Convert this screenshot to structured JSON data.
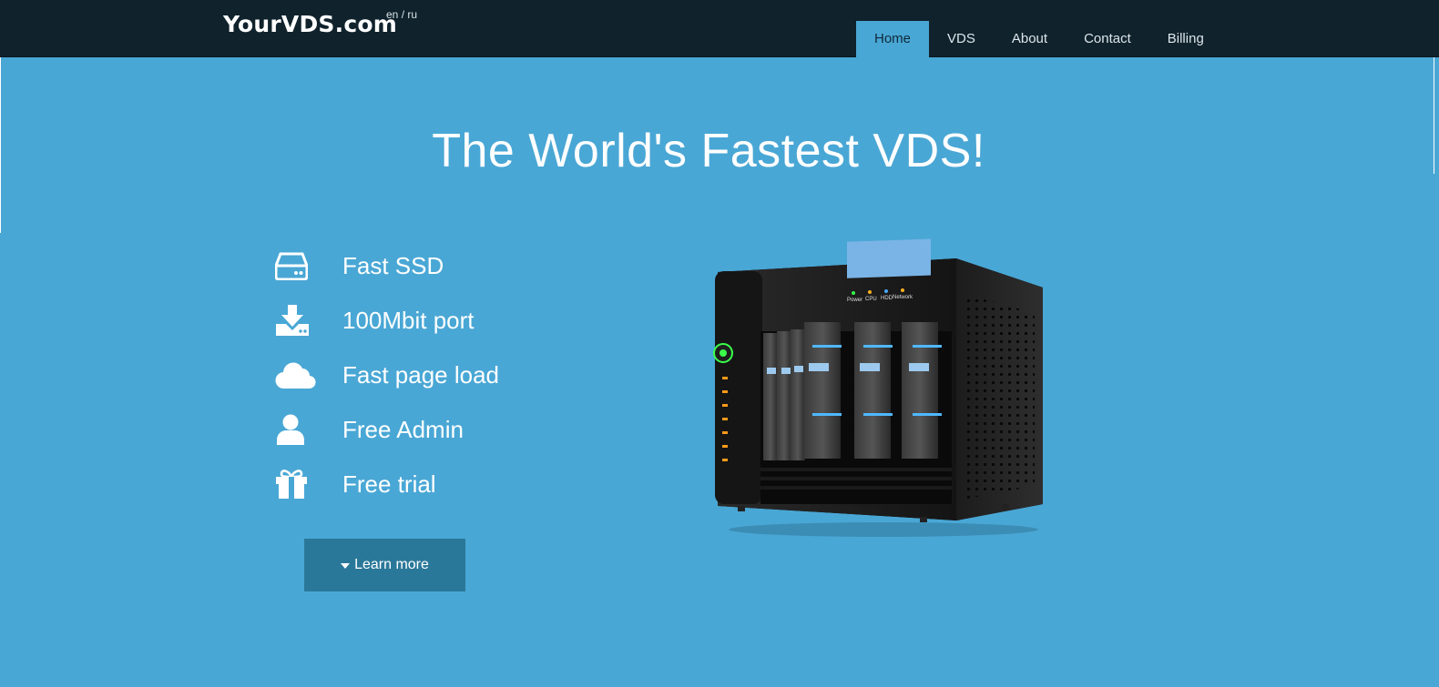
{
  "brand": {
    "name": "YourVDS.com",
    "lang_en": "en",
    "lang_sep": " / ",
    "lang_ru": "ru"
  },
  "nav": {
    "items": [
      {
        "label": "Home",
        "active": true
      },
      {
        "label": "VDS"
      },
      {
        "label": "About"
      },
      {
        "label": "Contact"
      },
      {
        "label": "Billing"
      }
    ]
  },
  "hero": {
    "title": "The World's Fastest VDS!",
    "features": [
      {
        "icon": "hdd-icon",
        "label": "Fast SSD"
      },
      {
        "icon": "download-icon",
        "label": "100Mbit port"
      },
      {
        "icon": "cloud-icon",
        "label": "Fast page load"
      },
      {
        "icon": "user-icon",
        "label": "Free Admin"
      },
      {
        "icon": "gift-icon",
        "label": "Free trial"
      }
    ],
    "cta_label": "Learn more",
    "server_panel_labels": [
      "Power",
      "CPU",
      "HDD",
      "Network"
    ]
  },
  "colors": {
    "background": "#49a7d5",
    "navbar": "#10222c",
    "button": "#2a7899"
  }
}
